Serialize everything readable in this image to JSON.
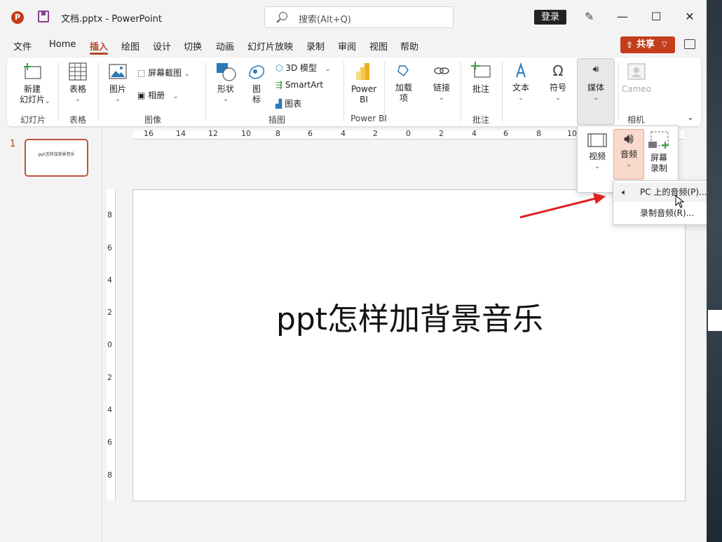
{
  "titlebar": {
    "logo": "P",
    "title": "文档.pptx  -  PowerPoint",
    "search_placeholder": "搜索(Alt+Q)",
    "login": "登录",
    "minimize": "—",
    "maximize": "☐",
    "close": "✕"
  },
  "menu": {
    "tabs": [
      "文件",
      "Home",
      "插入",
      "绘图",
      "设计",
      "切换",
      "动画",
      "幻灯片放映",
      "录制",
      "审阅",
      "视图",
      "帮助"
    ],
    "active": "插入",
    "share": "共享"
  },
  "ribbon": {
    "new_slide": "新建\n幻灯片",
    "table": "表格",
    "picture": "图片",
    "screenshot": "屏幕截图",
    "album": "相册",
    "shapes": "形状",
    "icons": "图\n标",
    "model3d": "3D 模型",
    "smartart": "SmartArt",
    "chart": "图表",
    "powerbi": "Power\nBI",
    "addins": "加载\n项",
    "link": "链接",
    "comment": "批注",
    "text": "文本",
    "symbol": "符号",
    "media": "媒体",
    "cameo": "Cameo",
    "groups": {
      "slides": "幻灯片",
      "tables": "表格",
      "images": "图像",
      "illustrations": "插图",
      "powerbi": "Power BI",
      "comments": "批注",
      "camera": "相机"
    }
  },
  "media_dropdown": {
    "video": "视频",
    "audio": "音频",
    "screen_recording": "屏幕\n录制"
  },
  "audio_menu": {
    "pc_audio": "PC 上的音频(P)...",
    "record_audio": "录制音频(R)..."
  },
  "thumbnails": {
    "number": "1",
    "thumb_text": "ppt怎样加背景音乐"
  },
  "slide": {
    "title": "ppt怎样加背景音乐"
  },
  "rulers": {
    "horizontal": [
      "16",
      "14",
      "12",
      "10",
      "8",
      "6",
      "4",
      "2",
      "0",
      "2",
      "4",
      "6",
      "8",
      "10"
    ],
    "vertical": [
      "8",
      "6",
      "4",
      "2",
      "0",
      "2",
      "4",
      "6",
      "8"
    ]
  },
  "colors": {
    "accent": "#b7472a",
    "logo": "#c43e1c",
    "arrow": "#e02020"
  }
}
